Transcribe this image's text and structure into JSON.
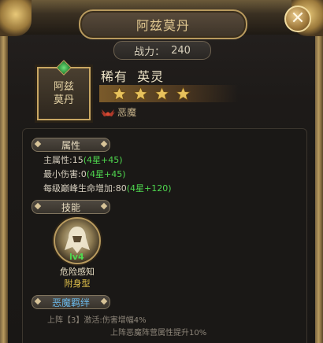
{
  "window": {
    "title": "阿兹莫丹",
    "close_icon": "close-icon"
  },
  "power": {
    "label": "战力：",
    "value": "240"
  },
  "hero": {
    "portrait_name_line1": "阿兹",
    "portrait_name_line2": "莫丹",
    "rarity": "稀有",
    "class": "英灵",
    "stars": 4,
    "faction": "恶魔",
    "star_color": "#e8c25c"
  },
  "attributes": {
    "header": "属性",
    "lines": [
      {
        "label": "主属性:15",
        "bonus": "(4星+45)"
      },
      {
        "label": "最小伤害:0",
        "bonus": "(4星+45)"
      },
      {
        "label": "每级巅峰生命增加:80",
        "bonus": "(4星+120)"
      }
    ]
  },
  "skills": {
    "header": "技能",
    "items": [
      {
        "level": "lv4",
        "name": "危险感知",
        "type": "附身型",
        "icon": "hooded-figure-icon"
      }
    ]
  },
  "bond": {
    "header": "恶魔羁绊",
    "lines": [
      "上阵【3】激活:伤害增幅4%",
      "上阵恶魔阵营属性提升10%"
    ]
  },
  "colors": {
    "green_bonus": "#4fd84f",
    "gold_border": "#c9a763"
  }
}
